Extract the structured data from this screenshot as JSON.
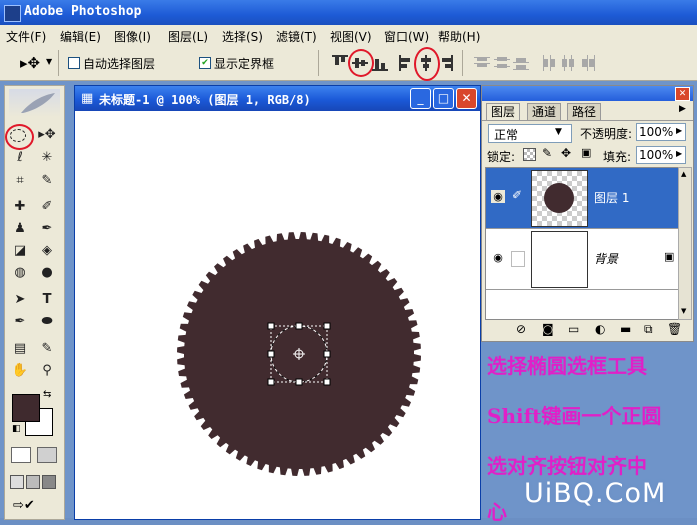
{
  "app": {
    "title": "Adobe Photoshop"
  },
  "menu": [
    "文件(F)",
    "编辑(E)",
    "图像(I)",
    "图层(L)",
    "选择(S)",
    "滤镜(T)",
    "视图(V)",
    "窗口(W)",
    "帮助(H)"
  ],
  "options": {
    "auto_select_label": "自动选择图层",
    "show_bounds_label": "显示定界框",
    "show_bounds_checked": true
  },
  "document": {
    "title": "未标题-1 @ 100% (图层 1, RGB/8)"
  },
  "layers_panel": {
    "tabs": [
      "图层",
      "通道",
      "路径"
    ],
    "blend_mode": "正常",
    "opacity_label": "不透明度:",
    "opacity_value": "100%",
    "lock_label": "锁定:",
    "fill_label": "填充:",
    "fill_value": "100%",
    "layers": [
      {
        "name": "图层 1",
        "selected": true
      },
      {
        "name": "背景",
        "selected": false,
        "locked": true
      }
    ]
  },
  "colors": {
    "foreground": "#3f2a2e",
    "background": "#ffffff",
    "gear": "#412b2f",
    "annotation": "#e020c8"
  },
  "annotation": {
    "line1": "选择椭圆选框工具",
    "line2": "Shift键画一个正圆",
    "line3": "选对齐按钮对齐中",
    "line4": "心"
  },
  "watermark": "UiBQ.CoM"
}
